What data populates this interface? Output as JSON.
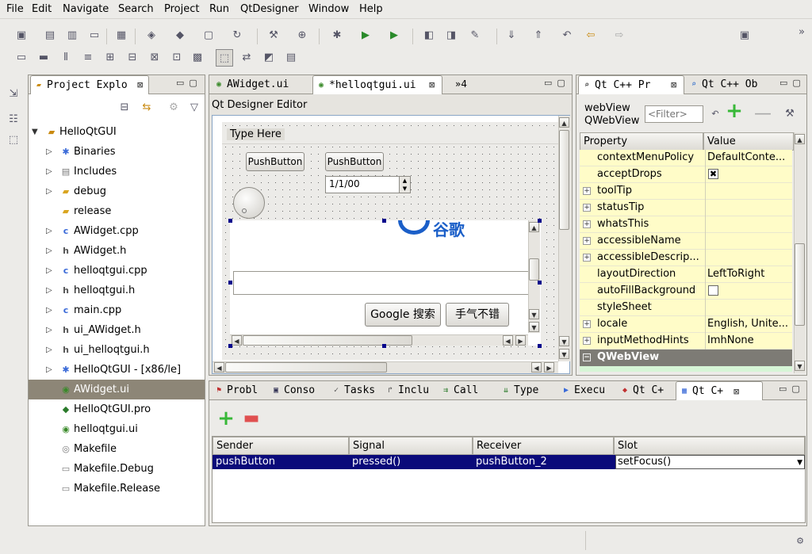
{
  "menu": [
    "File",
    "Edit",
    "Navigate",
    "Search",
    "Project",
    "Run",
    "QtDesigner",
    "Window",
    "Help"
  ],
  "project_explorer": {
    "tab_label": "Project Explo",
    "items": [
      {
        "label": "HelloQtGUI",
        "level": 0,
        "expanded": true
      },
      {
        "label": "Binaries",
        "level": 1
      },
      {
        "label": "Includes",
        "level": 1
      },
      {
        "label": "debug",
        "level": 1
      },
      {
        "label": "release",
        "level": 1
      },
      {
        "label": "AWidget.cpp",
        "level": 1
      },
      {
        "label": "AWidget.h",
        "level": 1
      },
      {
        "label": "helloqtgui.cpp",
        "level": 1
      },
      {
        "label": "helloqtgui.h",
        "level": 1
      },
      {
        "label": "main.cpp",
        "level": 1
      },
      {
        "label": "ui_AWidget.h",
        "level": 1
      },
      {
        "label": "ui_helloqtgui.h",
        "level": 1
      },
      {
        "label": "HelloQtGUI - [x86/le]",
        "level": 1
      },
      {
        "label": "AWidget.ui",
        "level": 1,
        "selected": true
      },
      {
        "label": "HelloQtGUI.pro",
        "level": 1
      },
      {
        "label": "helloqtgui.ui",
        "level": 1
      },
      {
        "label": "Makefile",
        "level": 1
      },
      {
        "label": "Makefile.Debug",
        "level": 1
      },
      {
        "label": "Makefile.Release",
        "level": 1
      }
    ]
  },
  "editor": {
    "tabs": [
      {
        "label": "AWidget.ui"
      },
      {
        "label": "*helloqtgui.ui",
        "active": true
      }
    ],
    "overflow_label": "»4",
    "designer_title": "Qt Designer Editor",
    "menu_placeholder": "Type Here",
    "push_button_1": "PushButton",
    "push_button_2": "PushButton",
    "date_value": "1/1/00",
    "google_logo_text": "谷歌",
    "google_search_button": "Google 搜索",
    "lucky_button": "手气不错"
  },
  "properties": {
    "tabs": [
      {
        "label": "Qt C++ Pr",
        "active": true
      },
      {
        "label": "Qt C++ Ob"
      }
    ],
    "object_name": "webView",
    "object_class": "QWebView",
    "filter_placeholder": "<Filter>",
    "col_property": "Property",
    "col_value": "Value",
    "rows": [
      {
        "name": "contextMenuPolicy",
        "value": "DefaultConte..."
      },
      {
        "name": "acceptDrops",
        "value": "",
        "checkbox": true,
        "checked": true
      },
      {
        "name": "toolTip",
        "value": "",
        "expandable": true
      },
      {
        "name": "statusTip",
        "value": "",
        "expandable": true
      },
      {
        "name": "whatsThis",
        "value": "",
        "expandable": true
      },
      {
        "name": "accessibleName",
        "value": "",
        "expandable": true
      },
      {
        "name": "accessibleDescrip...",
        "value": "",
        "expandable": true
      },
      {
        "name": "layoutDirection",
        "value": "LeftToRight"
      },
      {
        "name": "autoFillBackground",
        "value": "",
        "checkbox": true,
        "checked": false
      },
      {
        "name": "styleSheet",
        "value": ""
      },
      {
        "name": "locale",
        "value": "English, Unite...",
        "expandable": true
      },
      {
        "name": "inputMethodHints",
        "value": "ImhNone",
        "expandable": true
      }
    ],
    "section_label": "QWebView"
  },
  "bottom": {
    "tabs": [
      {
        "label": "Probl"
      },
      {
        "label": "Conso"
      },
      {
        "label": "Tasks"
      },
      {
        "label": "Inclu"
      },
      {
        "label": "Call"
      },
      {
        "label": "Type"
      },
      {
        "label": "Execu"
      },
      {
        "label": "Qt C+"
      },
      {
        "label": "Qt C+",
        "active": true
      }
    ],
    "columns": [
      "Sender",
      "Signal",
      "Receiver",
      "Slot"
    ],
    "rows": [
      {
        "sender": "pushButton",
        "signal": "pressed()",
        "receiver": "pushButton_2",
        "slot": "setFocus()"
      }
    ]
  },
  "colors": {
    "selection": "#0a0a7a",
    "property_bg": "#fffcc8",
    "section_bg": "#7d7b75"
  }
}
